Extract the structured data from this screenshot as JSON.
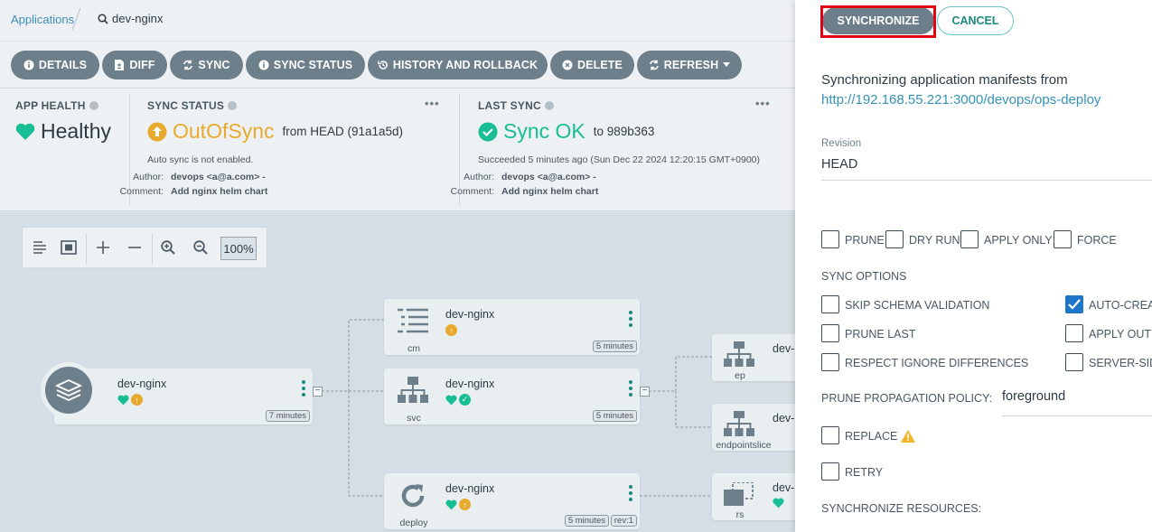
{
  "breadcrumb": {
    "root": "Applications",
    "current": "dev-nginx"
  },
  "toolbar": {
    "buttons": [
      {
        "label": "DETAILS",
        "icon": "info-icon"
      },
      {
        "label": "DIFF",
        "icon": "file-diff-icon"
      },
      {
        "label": "SYNC",
        "icon": "sync-icon"
      },
      {
        "label": "SYNC STATUS",
        "icon": "info-icon"
      },
      {
        "label": "HISTORY AND ROLLBACK",
        "icon": "history-icon"
      },
      {
        "label": "DELETE",
        "icon": "delete-icon"
      },
      {
        "label": "REFRESH",
        "icon": "refresh-icon"
      }
    ]
  },
  "status": {
    "app_health": {
      "title": "APP HEALTH",
      "value": "Healthy"
    },
    "sync_status": {
      "title": "SYNC STATUS",
      "value": "OutOfSync",
      "from": "from HEAD (91a1a5d)",
      "note": "Auto sync is not enabled.",
      "author_label": "Author:",
      "author": "devops <a@a.com> -",
      "comment_label": "Comment:",
      "comment": "Add nginx helm chart"
    },
    "last_sync": {
      "title": "LAST SYNC",
      "value": "Sync OK",
      "to": "to 989b363",
      "note": "Succeeded 5 minutes ago (Sun Dec 22 2024 12:20:15 GMT+0900)",
      "author_label": "Author:",
      "author": "devops <a@a.com> -",
      "comment_label": "Comment:",
      "comment": "Add nginx helm chart"
    },
    "menu_dots": "•••"
  },
  "zoom": {
    "level": "100%"
  },
  "graph": {
    "app": {
      "name": "dev-nginx",
      "age": "7 minutes"
    },
    "nodes": [
      {
        "name": "dev-nginx",
        "kind": "cm",
        "age": "5 minutes"
      },
      {
        "name": "dev-nginx",
        "kind": "svc",
        "age": "5 minutes"
      },
      {
        "name": "dev-nginx",
        "kind": "deploy",
        "age": "5 minutes",
        "rev": "rev:1"
      },
      {
        "name": "dev-",
        "kind": "ep"
      },
      {
        "name": "dev-",
        "kind": "endpointslice"
      },
      {
        "name": "dev-",
        "kind": "rs"
      }
    ]
  },
  "panel": {
    "synchronize_label": "SYNCHRONIZE",
    "cancel_label": "CANCEL",
    "heading": "Synchronizing application manifests from",
    "repo_url": "http://192.168.55.221:3000/devops/ops-deploy",
    "revision_label": "Revision",
    "revision_value": "HEAD",
    "top_options": [
      "PRUNE",
      "DRY RUN",
      "APPLY ONLY",
      "FORCE"
    ],
    "sync_options_label": "SYNC OPTIONS",
    "sync_options_left": [
      "SKIP SCHEMA VALIDATION",
      "PRUNE LAST",
      "RESPECT IGNORE DIFFERENCES"
    ],
    "sync_options_right": [
      "AUTO-CREAT",
      "APPLY OUT",
      "SERVER-SID"
    ],
    "prune_policy_label": "PRUNE PROPAGATION POLICY:",
    "prune_policy_value": "foreground",
    "replace_label": "REPLACE",
    "retry_label": "RETRY",
    "resources_label": "SYNCHRONIZE RESOURCES:"
  },
  "colors": {
    "accent": "#1b8a7c",
    "healthy": "#18be94",
    "outofsync": "#e8aa2e",
    "highlight": "#e20012"
  }
}
